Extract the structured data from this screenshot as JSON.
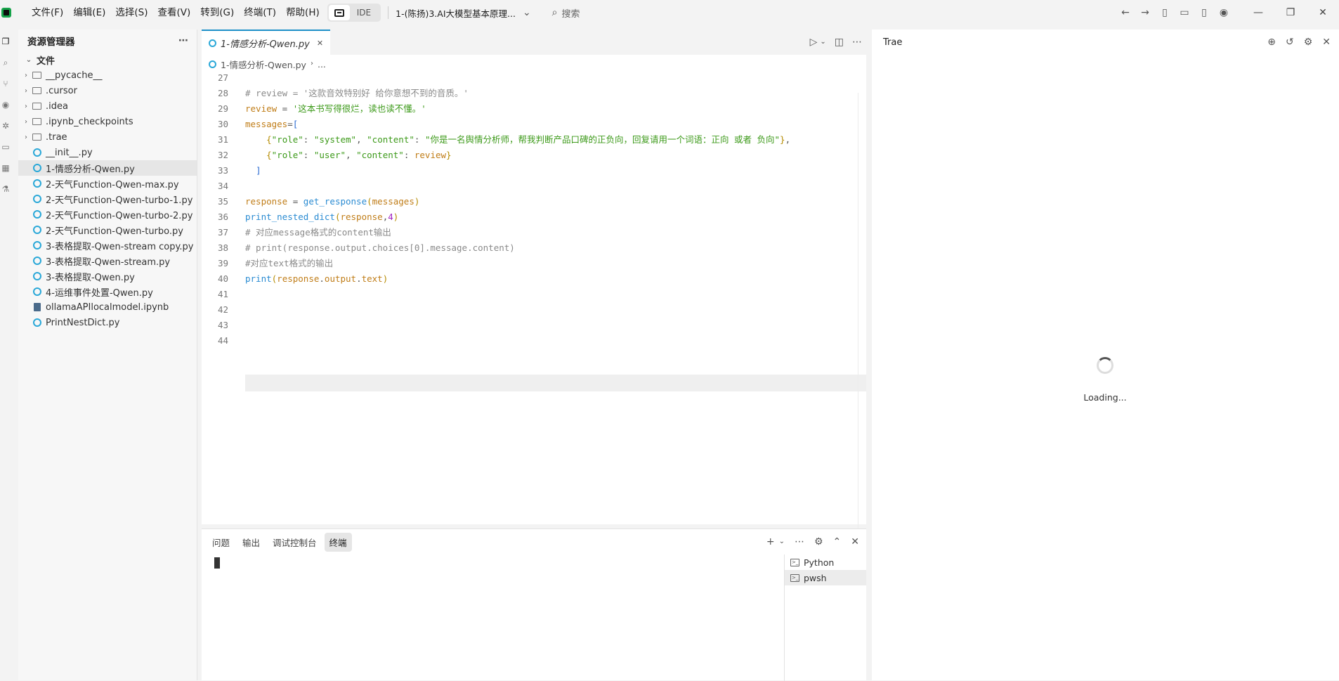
{
  "menu": [
    "文件(F)",
    "编辑(E)",
    "选择(S)",
    "查看(V)",
    "转到(G)",
    "终端(T)",
    "帮助(H)"
  ],
  "mode_label": "IDE",
  "project_title": "1-(陈扬)3.AI大模型基本原理...",
  "search_placeholder": "搜索",
  "sidebar": {
    "title": "资源管理器",
    "root": "文件",
    "items": [
      {
        "name": "__pycache__",
        "type": "folder"
      },
      {
        "name": ".cursor",
        "type": "folder"
      },
      {
        "name": ".idea",
        "type": "folder"
      },
      {
        "name": ".ipynb_checkpoints",
        "type": "folder"
      },
      {
        "name": ".trae",
        "type": "folder"
      },
      {
        "name": "__init__.py",
        "type": "py"
      },
      {
        "name": "1-情感分析-Qwen.py",
        "type": "py",
        "selected": true
      },
      {
        "name": "2-天气Function-Qwen-max.py",
        "type": "py"
      },
      {
        "name": "2-天气Function-Qwen-turbo-1.py",
        "type": "py"
      },
      {
        "name": "2-天气Function-Qwen-turbo-2.py",
        "type": "py"
      },
      {
        "name": "2-天气Function-Qwen-turbo.py",
        "type": "py"
      },
      {
        "name": "3-表格提取-Qwen-stream copy.py",
        "type": "py"
      },
      {
        "name": "3-表格提取-Qwen-stream.py",
        "type": "py"
      },
      {
        "name": "3-表格提取-Qwen.py",
        "type": "py"
      },
      {
        "name": "4-运维事件处置-Qwen.py",
        "type": "py"
      },
      {
        "name": "ollamaAPIlocalmodel.ipynb",
        "type": "nb"
      },
      {
        "name": "PrintNestDict.py",
        "type": "py"
      }
    ]
  },
  "editor": {
    "tab_label": "1-情感分析-Qwen.py",
    "breadcrumb_file": "1-情感分析-Qwen.py",
    "breadcrumb_more": "...",
    "line_numbers": [
      "27",
      "28",
      "29",
      "30",
      "31",
      "32",
      "33",
      "34",
      "35",
      "36",
      "37",
      "38",
      "39",
      "40",
      "41",
      "42",
      "43",
      "44"
    ],
    "code": {
      "l28": "# review = '这款音效特别好 给你意想不到的音质。'",
      "l29_var": "review",
      "l29_str": "'这本书写得很烂，读也读不懂。'",
      "l30_var": "messages",
      "l31_k1": "\"role\"",
      "l31_v1": "\"system\"",
      "l31_k2": "\"content\"",
      "l31_v2": "\"你是一名舆情分析师，帮我判断产品口碑的正负向，回复请用一个词语：正向 或者 负向\"",
      "l32_k1": "\"role\"",
      "l32_v1": "\"user\"",
      "l32_k2": "\"content\"",
      "l32_v2": "review",
      "l35_var": "response",
      "l35_fn": "get_response",
      "l35_arg": "messages",
      "l36_fn": "print_nested_dict",
      "l36_arg": "response",
      "l36_num": "4",
      "l37": "# 对应message格式的content输出",
      "l38": "# print(response.output.choices[0].message.content)",
      "l39": "#对应text格式的输出",
      "l40_fn": "print",
      "l40_a": "response",
      "l40_b": "output",
      "l40_c": "text"
    }
  },
  "panel": {
    "tabs": [
      "问题",
      "输出",
      "调试控制台",
      "终端"
    ],
    "active_tab": "终端",
    "terminals": [
      "Python",
      "pwsh"
    ]
  },
  "chat": {
    "title": "Trae",
    "loading": "Loading..."
  }
}
